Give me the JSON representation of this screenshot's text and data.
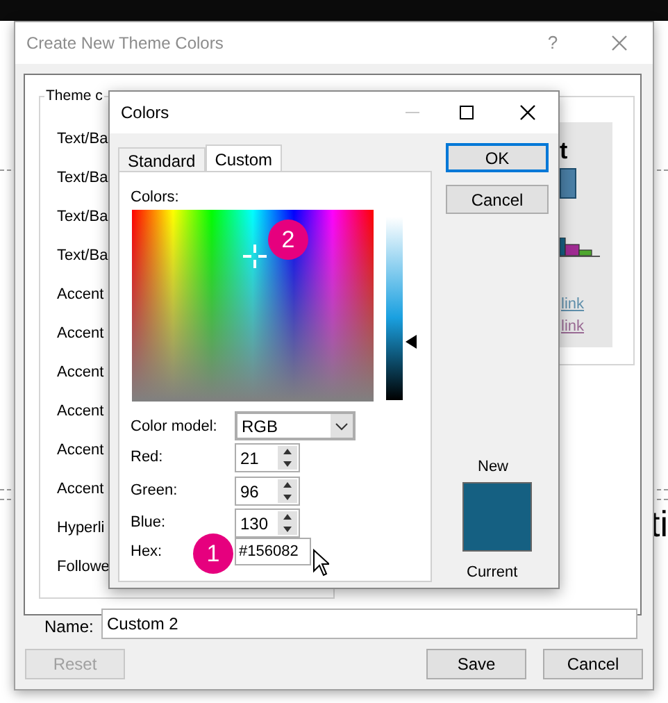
{
  "document": {
    "texts": [
      "ti"
    ]
  },
  "dialog": {
    "title": "Create New Theme Colors",
    "help": "?",
    "theme_colors": {
      "legend": "Theme c",
      "rows": [
        "Text/Ba",
        "Text/Ba",
        "Text/Ba",
        "Text/Ba",
        "Accent",
        "Accent",
        "Accent",
        "Accent",
        "Accent",
        "Accent",
        "Hyperli",
        "Followe"
      ]
    },
    "sample": {
      "heading": "t",
      "links": [
        "link",
        "link"
      ]
    },
    "name": {
      "label": "Name:",
      "value": "Custom 2"
    },
    "buttons": [
      {
        "label": "Reset",
        "disabled": true
      },
      {
        "label": "Save",
        "disabled": false
      },
      {
        "label": "Cancel",
        "disabled": false
      }
    ]
  },
  "colors_dialog": {
    "title": "Colors",
    "tabs": [
      {
        "label": "Standard",
        "selected": false
      },
      {
        "label": "Custom",
        "selected": true
      }
    ],
    "colors_label": "Colors:",
    "luminance": {
      "level": 0.32
    },
    "color_model": {
      "label": "Color model:",
      "value": "RGB"
    },
    "fields": [
      {
        "label": "Red:",
        "value": "21"
      },
      {
        "label": "Green:",
        "value": "96"
      },
      {
        "label": "Blue:",
        "value": "130"
      }
    ],
    "hex": {
      "label": "Hex:",
      "value": "#156082"
    },
    "buttons": [
      {
        "label": "OK",
        "default": true
      },
      {
        "label": "Cancel",
        "default": false
      }
    ],
    "preview": {
      "new_label": "New",
      "current_label": "Current",
      "color": "#156082"
    }
  },
  "callouts": [
    {
      "number": "1"
    },
    {
      "number": "2"
    }
  ]
}
